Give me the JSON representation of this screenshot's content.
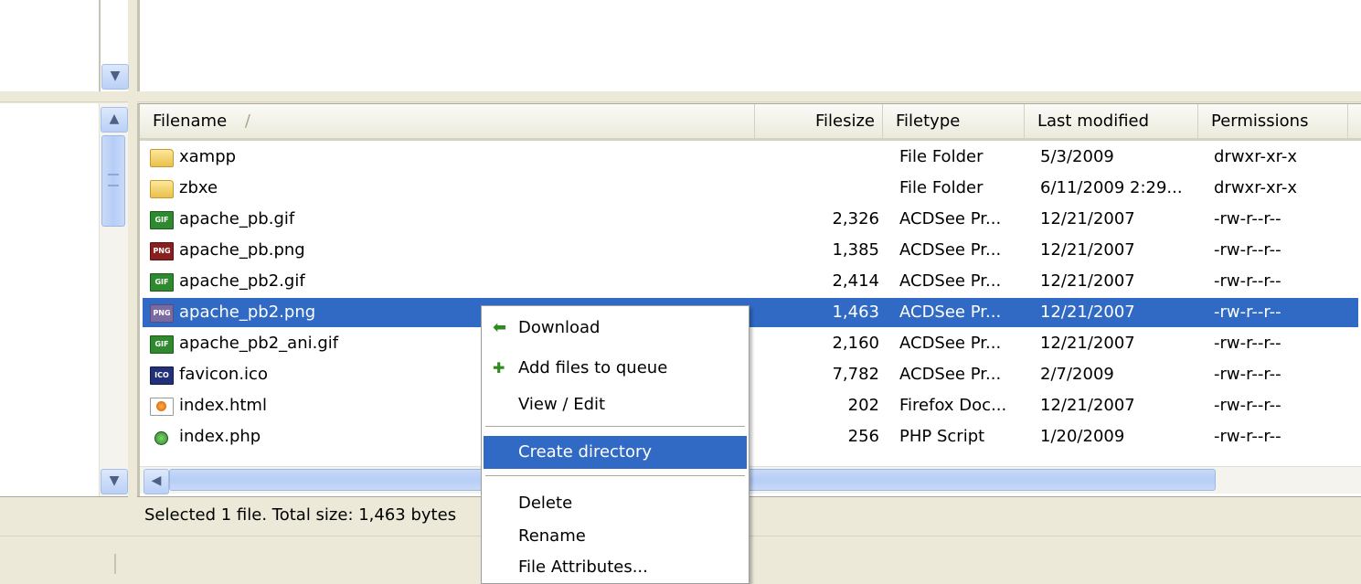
{
  "file_list": {
    "columns": [
      {
        "label": "Filename",
        "sort_indicator": "/"
      },
      {
        "label": "Filesize"
      },
      {
        "label": "Filetype"
      },
      {
        "label": "Last modified"
      },
      {
        "label": "Permissions"
      }
    ],
    "rows": [
      {
        "name": "xampp",
        "size": "",
        "type": "File Folder",
        "modified": "5/3/2009",
        "perms": "drwxr-xr-x",
        "icon": "folder-icon",
        "selected": false
      },
      {
        "name": "zbxe",
        "size": "",
        "type": "File Folder",
        "modified": "6/11/2009 2:29...",
        "perms": "drwxr-xr-x",
        "icon": "folder-icon",
        "selected": false
      },
      {
        "name": "apache_pb.gif",
        "size": "2,326",
        "type": "ACDSee Pr...",
        "modified": "12/21/2007",
        "perms": "-rw-r--r--",
        "icon": "gif-file-icon",
        "selected": false
      },
      {
        "name": "apache_pb.png",
        "size": "1,385",
        "type": "ACDSee Pr...",
        "modified": "12/21/2007",
        "perms": "-rw-r--r--",
        "icon": "png-file-icon",
        "selected": false
      },
      {
        "name": "apache_pb2.gif",
        "size": "2,414",
        "type": "ACDSee Pr...",
        "modified": "12/21/2007",
        "perms": "-rw-r--r--",
        "icon": "gif-file-icon",
        "selected": false
      },
      {
        "name": "apache_pb2.png",
        "size": "1,463",
        "type": "ACDSee Pr...",
        "modified": "12/21/2007",
        "perms": "-rw-r--r--",
        "icon": "png-file-icon",
        "selected": true
      },
      {
        "name": "apache_pb2_ani.gif",
        "size": "2,160",
        "type": "ACDSee Pr...",
        "modified": "12/21/2007",
        "perms": "-rw-r--r--",
        "icon": "gif-file-icon",
        "selected": false
      },
      {
        "name": "favicon.ico",
        "size": "7,782",
        "type": "ACDSee Pr...",
        "modified": "2/7/2009",
        "perms": "-rw-r--r--",
        "icon": "ico-file-icon",
        "selected": false
      },
      {
        "name": "index.html",
        "size": "202",
        "type": "Firefox Doc...",
        "modified": "12/21/2007",
        "perms": "-rw-r--r--",
        "icon": "html-file-icon",
        "selected": false
      },
      {
        "name": "index.php",
        "size": "256",
        "type": "PHP Script",
        "modified": "1/20/2009",
        "perms": "-rw-r--r--",
        "icon": "php-file-icon",
        "selected": false
      }
    ],
    "icon_badges": {
      "gif": "GIF",
      "png": "PNG",
      "ico": "ICO"
    }
  },
  "status": {
    "text": "Selected 1 file. Total size: 1,463 bytes"
  },
  "context_menu": {
    "items": [
      {
        "label": "Download",
        "icon": "download-arrow-icon"
      },
      {
        "label": "Add files to queue",
        "icon": "add-to-queue-icon"
      },
      {
        "label": "View / Edit"
      },
      {
        "label": "Create directory",
        "highlighted": true
      },
      {
        "label": "Delete"
      },
      {
        "label": "Rename"
      },
      {
        "label": "File Attributes..."
      }
    ]
  },
  "colors": {
    "selection": "#316ac5",
    "chrome": "#ece9d8",
    "icon_green": "#2e8b1e"
  }
}
